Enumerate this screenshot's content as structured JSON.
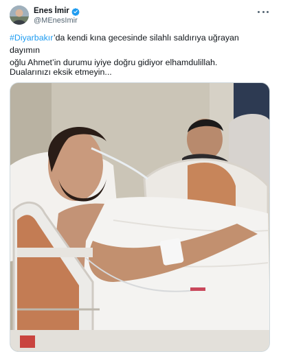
{
  "author": {
    "display_name": "Enes İmir",
    "handle": "@MEnesImir",
    "verified": true,
    "verified_color": "#1d9bf0"
  },
  "tweet": {
    "hashtag": "#Diyarbakır",
    "line1_rest": "’da kendi kına gecesinde silahlı saldırıya uğrayan dayımın",
    "line2": "oğlu Ahmet’in durumu iyiye doğru gidiyor elhamdulillah.",
    "line3": "Dualarınızı eksik etmeyin..."
  },
  "icons": {
    "more": "more-horizontal-icon",
    "verified": "verified-badge-icon"
  },
  "colors": {
    "accent": "#1d9bf0",
    "text": "#0f1419",
    "secondary_text": "#536471"
  }
}
